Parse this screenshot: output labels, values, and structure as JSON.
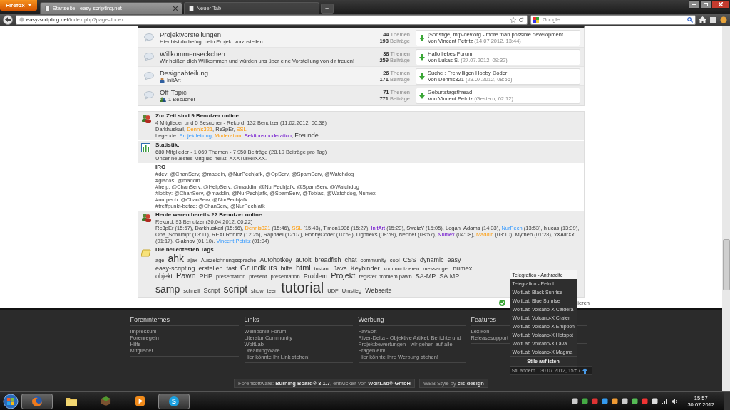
{
  "browser": {
    "app_button": "Firefox",
    "tabs": [
      {
        "label": "Startseite - easy-scripting.net",
        "selected": true
      },
      {
        "label": "Neuer Tab",
        "selected": false
      }
    ],
    "new_tab": "+",
    "url": {
      "host": "easy-scripting.net",
      "path": "/index.php?page=Index"
    },
    "search": {
      "placeholder": "Google"
    }
  },
  "forums": [
    {
      "title": "Projektvorstellungen",
      "sub": {
        "kind": "description",
        "text": "Hier bist du befugt dein Projekt vorzustellen."
      },
      "threads": "44",
      "threads_label": "Themen",
      "posts": "198",
      "posts_label": "Beiträge",
      "last_post": {
        "title": "[Sonstige] mtp-dev.org - more than possible development",
        "by": "Von Vincent Petritz",
        "date": "(14.07.2012, 13:44)"
      }
    },
    {
      "title": "Willkommenseckchen",
      "sub": {
        "kind": "description",
        "text": "Wir heißen dich Willkommen und würden uns über eine Vorstellung von dir freuen!"
      },
      "threads": "38",
      "threads_label": "Themen",
      "posts": "259",
      "posts_label": "Beiträge",
      "last_post": {
        "title": "Hallo liebes Forum",
        "by": "Von Lukas S.",
        "date": "(27.07.2012, 09:32)"
      }
    },
    {
      "title": "Designabteilung",
      "sub": {
        "kind": "moderator",
        "text": "InitArt"
      },
      "threads": "26",
      "threads_label": "Themen",
      "posts": "171",
      "posts_label": "Beiträge",
      "last_post": {
        "title": "Suche : Freiwilligen Hobby Coder",
        "by": "Von Dennis321",
        "date": "(23.07.2012, 08:56)"
      }
    },
    {
      "title": "Off-Topic",
      "sub": {
        "kind": "visitors",
        "text": "1 Besucher"
      },
      "threads": "71",
      "threads_label": "Themen",
      "posts": "771",
      "posts_label": "Beiträge",
      "last_post": {
        "title": "Geburtstagsthread",
        "by": "Von Vincent Petritz",
        "date": "(Gestern, 02:12)"
      }
    }
  ],
  "online": {
    "title": "Zur Zeit sind 9 Benutzer online:",
    "summary": "4 Mitglieder und 5 Besucher - Rekord: 132 Benutzer (11.02.2012, 00:38)",
    "separator": ", ",
    "users": [
      {
        "name": "Darkhuskarl",
        "kind": "member"
      },
      {
        "name": "Dennis321",
        "kind": "moderator"
      },
      {
        "name": "Re3pEr",
        "kind": "member"
      },
      {
        "name": "SSL",
        "kind": "moderator"
      }
    ],
    "legend_label": "Legende:",
    "legend": [
      {
        "name": "Projektleitung",
        "kind": "lead"
      },
      {
        "name": "Moderation",
        "kind": "moderator"
      },
      {
        "name": "Sektionsmoderation",
        "kind": "section"
      },
      {
        "name": "Freunde",
        "kind": "friend"
      }
    ]
  },
  "statistics": {
    "title": "Statistik:",
    "lines": [
      "680 Mitglieder - 1 069 Themen - 7 950 Beiträge (28,19 Beiträge pro Tag)",
      "Unser neuestes Mitglied heißt: XXXTurkeiXXX."
    ]
  },
  "irc": {
    "title": "IRC",
    "lines": [
      "#dev: @ChanServ, @maddin, @NurPech|afk, @OpServ, @SpamServ, @Watchdog",
      "#glados: @maddin",
      "#help: @ChanServ, @HelpServ, @maddin, @NurPech|afk, @SpamServ, @Watchdog",
      "#lobby: @ChanServ, @maddin, @NurPech|afk, @SpamServ, @Tobias, @Watchdog, Numex",
      "#nurpech: @ChanServ, @NurPech|afk",
      "#treffpunkt-betze: @ChanServ, @NurPech|afk"
    ]
  },
  "today": {
    "title": "Heute waren bereits 22 Benutzer online:",
    "record": "Rekord: 93 Benutzer (30.04.2012, 00:22)",
    "separator": ", ",
    "users": [
      {
        "name": "Re3pEr",
        "time": "(15:57)",
        "kind": "member"
      },
      {
        "name": "Darkhuskarl",
        "time": "(15:56)",
        "kind": "member"
      },
      {
        "name": "Dennis321",
        "time": "(15:46)",
        "kind": "moderator"
      },
      {
        "name": "SSL",
        "time": "(15:43)",
        "kind": "moderator"
      },
      {
        "name": "Timon1986",
        "time": "(15:27)",
        "kind": "member"
      },
      {
        "name": "InitArt",
        "time": "(15:23)",
        "kind": "section"
      },
      {
        "name": "SweizY",
        "time": "(15:05)",
        "kind": "member"
      },
      {
        "name": "Logan_Adams",
        "time": "(14:33)",
        "kind": "member"
      },
      {
        "name": "NurPech",
        "time": "(13:53)",
        "kind": "lead"
      },
      {
        "name": "hlucas",
        "time": "(13:39)",
        "kind": "member"
      },
      {
        "name": "Opa_Schlumpf",
        "time": "(13:11)",
        "kind": "member"
      },
      {
        "name": "REALRonicz",
        "time": "(12:25)",
        "kind": "member"
      },
      {
        "name": "Raphael",
        "time": "(12:07)",
        "kind": "member"
      },
      {
        "name": "HobbyCoder",
        "time": "(10:59)",
        "kind": "member"
      },
      {
        "name": "Lightleks",
        "time": "(08:59)",
        "kind": "member"
      },
      {
        "name": "Neoner",
        "time": "(08:57)",
        "kind": "member"
      },
      {
        "name": "Numex",
        "time": "(04:08)",
        "kind": "section"
      },
      {
        "name": "Maddin",
        "time": "(03:10)",
        "kind": "moderator"
      },
      {
        "name": "Mythen",
        "time": "(01:28)",
        "kind": "member"
      },
      {
        "name": "xXAiirXx",
        "time": "(01:17)",
        "kind": "member"
      },
      {
        "name": "Glaknov",
        "time": "(01:10)",
        "kind": "member"
      },
      {
        "name": "Vincent Petritz",
        "time": "(01:04)",
        "kind": "lead"
      }
    ]
  },
  "tags": {
    "title": "Die beliebtesten Tags",
    "items": [
      {
        "label": "age",
        "kind": "small"
      },
      {
        "label": "ahk",
        "kind": "xlarge"
      },
      {
        "label": "ajax",
        "kind": "small"
      },
      {
        "label": "Auszeichnungssprache",
        "kind": "small"
      },
      {
        "label": "Autohotkey",
        "kind": "medium"
      },
      {
        "label": "autoit",
        "kind": "medium"
      },
      {
        "label": "breadfish",
        "kind": "medium"
      },
      {
        "label": "chat",
        "kind": "medium"
      },
      {
        "label": "community",
        "kind": "small"
      },
      {
        "label": "cool",
        "kind": "small"
      },
      {
        "label": "CSS",
        "kind": "medium"
      },
      {
        "label": "dynamic",
        "kind": "medium"
      },
      {
        "label": "easy",
        "kind": "medium"
      },
      {
        "label": "easy-scripting",
        "kind": "medium"
      },
      {
        "label": "erstellen",
        "kind": "medium"
      },
      {
        "label": "fast",
        "kind": "medium"
      },
      {
        "label": "Grundkurs",
        "kind": "large"
      },
      {
        "label": "hilfe",
        "kind": "medium"
      },
      {
        "label": "html",
        "kind": "large"
      },
      {
        "label": "instant",
        "kind": "small"
      },
      {
        "label": "Java",
        "kind": "medium"
      },
      {
        "label": "Keybinder",
        "kind": "medium"
      },
      {
        "label": "kommunizieren",
        "kind": "small"
      },
      {
        "label": "messanger",
        "kind": "small"
      },
      {
        "label": "numex",
        "kind": "medium"
      },
      {
        "label": "objekt",
        "kind": "medium"
      },
      {
        "label": "Pawn",
        "kind": "large"
      },
      {
        "label": "PHP",
        "kind": "medium"
      },
      {
        "label": "presentation",
        "kind": "small"
      },
      {
        "label": "present",
        "kind": "small"
      },
      {
        "label": "presentation",
        "kind": "small"
      },
      {
        "label": "Problem",
        "kind": "medium"
      },
      {
        "label": "Projekt",
        "kind": "large"
      },
      {
        "label": "register problem pawn",
        "kind": "small"
      },
      {
        "label": "SA-MP",
        "kind": "medium"
      },
      {
        "label": "SA:MP",
        "kind": "medium"
      },
      {
        "label": "samp",
        "kind": "xlarge"
      },
      {
        "label": "schnell",
        "kind": "small"
      },
      {
        "label": "Script",
        "kind": "medium"
      },
      {
        "label": "script",
        "kind": "xlarge"
      },
      {
        "label": "show",
        "kind": "small"
      },
      {
        "label": "teen",
        "kind": "small"
      },
      {
        "label": "tutorial",
        "kind": "huge"
      },
      {
        "label": "UDF",
        "kind": "small"
      },
      {
        "label": "Umstieg",
        "kind": "small"
      },
      {
        "label": "Webseite",
        "kind": "medium"
      }
    ]
  },
  "mark_read": {
    "text": "ieren"
  },
  "footer": {
    "columns": [
      {
        "title": "Foreninternes",
        "links": [
          "Impressum",
          "Forenregeln",
          "Hilfe",
          "Mitglieder"
        ]
      },
      {
        "title": "Links",
        "links": [
          "Weinböhla Forum",
          "Literatur Community",
          "WoltLab",
          "DreamingWare",
          "Hier könnte Ihr Link stehen!"
        ]
      },
      {
        "title": "Werbung",
        "links": [
          "FavSoft",
          "River-Delta - Objektive Artikel, Berichte und Projektbewertungen - wir gehen auf alle Fragen ein!",
          "Hier könnte Ihre Werbung stehen!"
        ]
      },
      {
        "title": "Features",
        "links": [
          "Lexikon",
          "Releasesupport"
        ]
      }
    ],
    "style_menu": {
      "items": [
        {
          "label": "Telegrafico - Anthracite",
          "selected": true
        },
        {
          "label": "Telegrafico - Petrol",
          "selected": false
        },
        {
          "label": "WoltLab Black Sunrise",
          "selected": false
        },
        {
          "label": "WoltLab Blue Sunrise",
          "selected": false
        },
        {
          "label": "WoltLab Volcano-X Caldera",
          "selected": false
        },
        {
          "label": "WoltLab Volcano-X Crater",
          "selected": false
        },
        {
          "label": "WoltLab Volcano-X Eruption",
          "selected": false
        },
        {
          "label": "WoltLab Volcano-X Hotspot",
          "selected": false
        },
        {
          "label": "WoltLab Volcano-X Lava",
          "selected": false
        },
        {
          "label": "WoltLab Volcano-X Magma",
          "selected": false
        }
      ],
      "list_all": "Stile auflisten"
    },
    "style_bar": {
      "label": "Stil ändern",
      "datetime": "30.07.2012, 15:57"
    },
    "credits": [
      "Forensoftware: **Burning Board® 3.1.7**, entwickelt von **WoltLab® GmbH**",
      "WBB Style by **cls-design**"
    ]
  },
  "taskbar": {
    "apps": [
      {
        "kind": "browser",
        "selected": true
      },
      {
        "kind": "folder",
        "selected": false
      },
      {
        "kind": "block",
        "selected": false
      },
      {
        "kind": "player",
        "selected": false
      },
      {
        "kind": "chat",
        "selected": true
      }
    ],
    "time": "15:57",
    "date": "30.07.2012"
  }
}
